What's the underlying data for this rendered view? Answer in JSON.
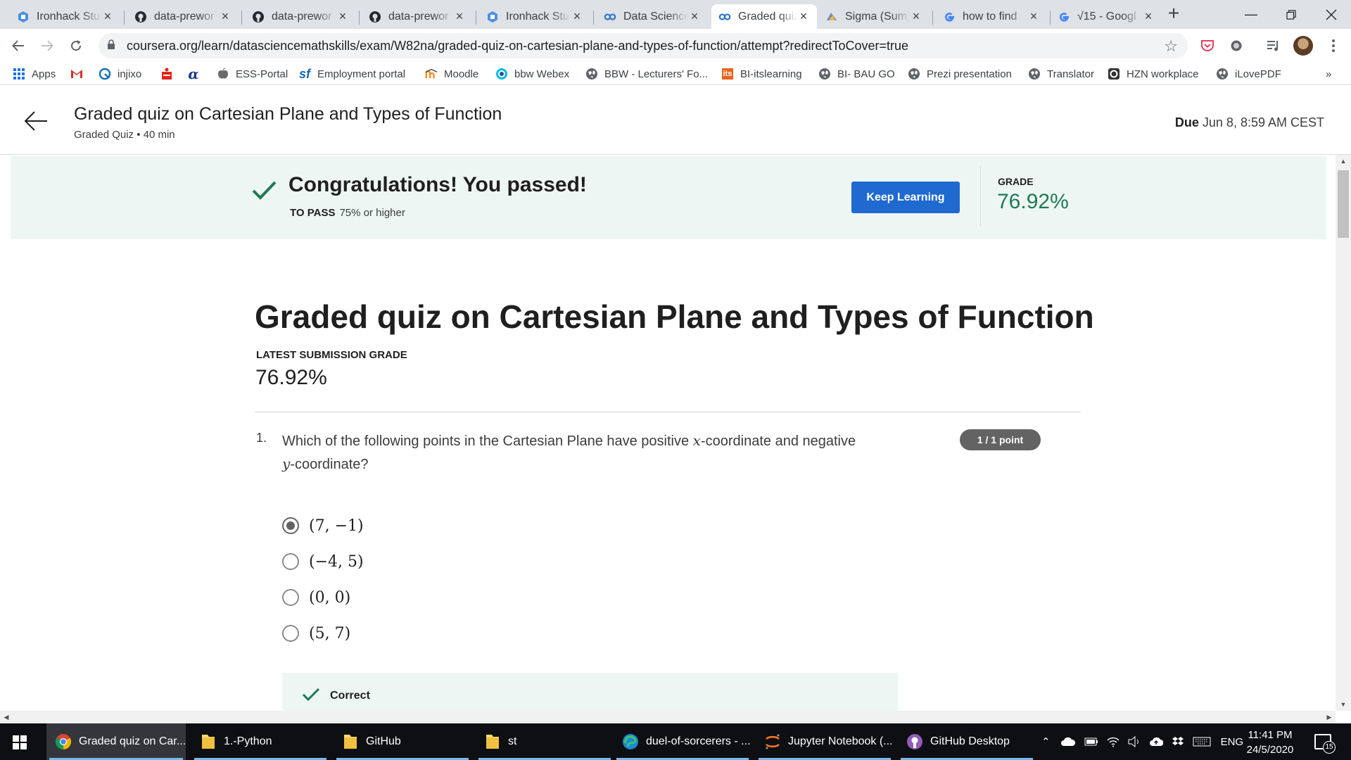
{
  "browser": {
    "tabs": [
      {
        "title": "Ironhack Stu",
        "icon": "ironhack-icon"
      },
      {
        "title": "data-prewor",
        "icon": "github-icon"
      },
      {
        "title": "data-prewor",
        "icon": "github-icon"
      },
      {
        "title": "data-prewor",
        "icon": "github-icon"
      },
      {
        "title": "Ironhack Stu",
        "icon": "ironhack-icon"
      },
      {
        "title": "Data Science",
        "icon": "coursera-icon"
      },
      {
        "title": "Graded quiz",
        "icon": "coursera-icon"
      },
      {
        "title": "Sigma (Sum)",
        "icon": "sigma-icon"
      },
      {
        "title": "how to find",
        "icon": "google-icon"
      },
      {
        "title": "√15 - Googl",
        "icon": "google-icon"
      }
    ],
    "active_tab": 6,
    "url": "coursera.org/learn/datasciencemathskills/exam/W82na/graded-quiz-on-cartesian-plane-and-types-of-function/attempt?redirectToCover=true",
    "bookmarks": [
      {
        "label": "Apps",
        "icon": "apps-grid-icon"
      },
      {
        "label": "",
        "icon": "gmail-icon"
      },
      {
        "label": "injixo",
        "icon": "injixo-icon"
      },
      {
        "label": "",
        "icon": "sparkasse-icon"
      },
      {
        "label": "",
        "icon": "alpha-icon"
      },
      {
        "label": "ESS-Portal",
        "icon": "apple-icon"
      },
      {
        "label": "Employment portal",
        "icon": "sf-icon"
      },
      {
        "label": "Moodle",
        "icon": "moodle-icon"
      },
      {
        "label": "bbw Webex",
        "icon": "webex-icon"
      },
      {
        "label": "BBW - Lecturers' Fo...",
        "icon": "globe-icon"
      },
      {
        "label": "BI-itslearning",
        "icon": "its-icon"
      },
      {
        "label": "BI- BAU GO",
        "icon": "globe-icon"
      },
      {
        "label": "Prezi presentation",
        "icon": "globe-icon"
      },
      {
        "label": "Translator",
        "icon": "globe-icon"
      },
      {
        "label": "HZN workplace",
        "icon": "hzn-icon"
      },
      {
        "label": "iLovePDF",
        "icon": "globe-icon"
      }
    ],
    "bookmarks_more": "»"
  },
  "header": {
    "title": "Graded quiz on Cartesian Plane and Types of Function",
    "subtitle": "Graded Quiz • 40 min",
    "due_label": "Due",
    "due_value": "Jun 8, 8:59 AM CEST"
  },
  "banner": {
    "message": "Congratulations! You passed!",
    "to_pass_label": "TO PASS",
    "to_pass_value": "75% or higher",
    "button": "Keep Learning",
    "grade_label": "GRADE",
    "grade_value": "76.92%",
    "accent_color": "#1d7a54",
    "button_color": "#1f69d1"
  },
  "quiz": {
    "title": "Graded quiz on Cartesian Plane and Types of Function",
    "latest_label": "LATEST SUBMISSION GRADE",
    "latest_value": "76.92%",
    "question": {
      "number": "1.",
      "text_before": "Which of the following points in the Cartesian Plane have positive ",
      "var_x": "x",
      "text_middle": "-coordinate and negative",
      "var_y": "y",
      "text_after": "-coordinate?",
      "points": "1 / 1 point",
      "options": [
        "(7, −1)",
        "(−4, 5)",
        "(0, 0)",
        "(5, 7)"
      ],
      "selected": 0,
      "feedback": "Correct"
    }
  },
  "taskbar": {
    "items": [
      {
        "label": "Graded quiz on Car...",
        "icon": "chrome-icon",
        "active": true
      },
      {
        "label": "1.-Python",
        "icon": "folder-icon"
      },
      {
        "label": "GitHub",
        "icon": "folder-icon"
      },
      {
        "label": "st",
        "icon": "folder-icon"
      },
      {
        "label": "duel-of-sorcerers - ...",
        "icon": "edge-icon"
      },
      {
        "label": "Jupyter Notebook (...",
        "icon": "jupyter-icon"
      },
      {
        "label": "GitHub Desktop",
        "icon": "github-desktop-icon"
      }
    ],
    "language": "ENG",
    "time": "11:41 PM",
    "date": "24/5/2020",
    "notifications": "15"
  }
}
